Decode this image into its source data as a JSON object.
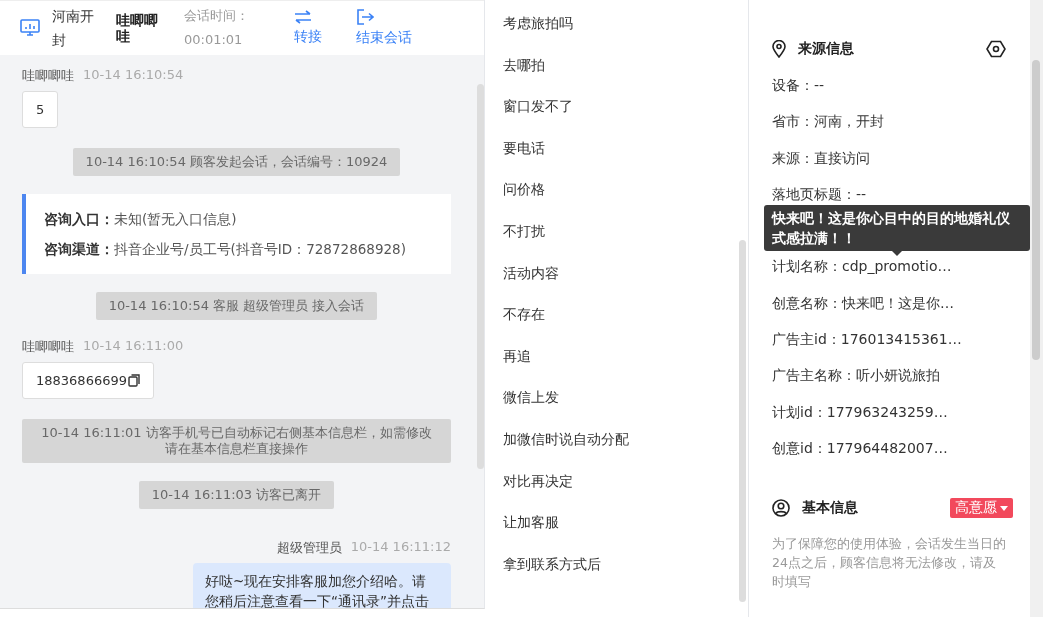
{
  "header": {
    "location": "河南开封",
    "visitor": "哇唧唧哇",
    "timer_label": "会话时间：",
    "timer": "00:01:01",
    "actions": [
      {
        "kind": "transfer",
        "label": "转接"
      },
      {
        "kind": "exit",
        "label": "结束会话"
      }
    ]
  },
  "messages": [
    {
      "kind": "visitor",
      "name": "哇唧唧哇",
      "time": "10-14 16:10:54",
      "text": "5",
      "copy": false
    },
    {
      "kind": "system",
      "text": "10-14 16:10:54 顾客发起会话，会话编号：10924"
    },
    {
      "kind": "entry",
      "lines": [
        {
          "label": "咨询入口：",
          "value": "未知(暂无入口信息)"
        },
        {
          "label": "咨询渠道：",
          "value": "抖音企业号/员工号(抖音号ID：72872868928)"
        }
      ]
    },
    {
      "kind": "system",
      "text": "10-14 16:10:54 客服 超级管理员 接入会话"
    },
    {
      "kind": "visitor",
      "name": "哇唧唧哇",
      "time": "10-14 16:11:00",
      "text": "18836866699",
      "copy": true
    },
    {
      "kind": "system",
      "text": "10-14 16:11:01 访客手机号已自动标记右侧基本信息栏，如需修改请在基本信息栏直接操作"
    },
    {
      "kind": "system",
      "text": "10-14 16:11:03 访客已离开"
    },
    {
      "kind": "agent",
      "name": "超级管理员",
      "time": "10-14 16:11:12",
      "text": "好哒~现在安排客服加您介绍哈。请您稍后注意查看一下“通讯录”并点击"
    }
  ],
  "quick_replies": [
    "考虑旅拍吗",
    "去哪拍",
    "窗口发不了",
    "要电话",
    "问价格",
    "不打扰",
    "活动内容",
    "不存在",
    "再追",
    "微信上发",
    "加微信时说自动分配",
    "对比再决定",
    "让加客服",
    "拿到联系方式后"
  ],
  "source_info": {
    "title": "来源信息",
    "fields": [
      "设备：--",
      "省市：河南，开封",
      "来源：直接访问",
      "落地页标题：--",
      "计划名称：cdp_promotio…",
      "创意名称：快来吧！这是你…",
      "广告主id：176013415361…",
      "广告主名称：听小妍说旅拍",
      "计划id：177963243259…",
      "创意id：177964482007…"
    ],
    "tooltip": "快来吧！这是你心目中的目的地婚礼仪式感拉满！！"
  },
  "basic_info": {
    "title": "基本信息",
    "intent": "高意愿",
    "note": "为了保障您的使用体验，会话发生当日的24点之后，顾客信息将无法修改，请及时填写"
  }
}
